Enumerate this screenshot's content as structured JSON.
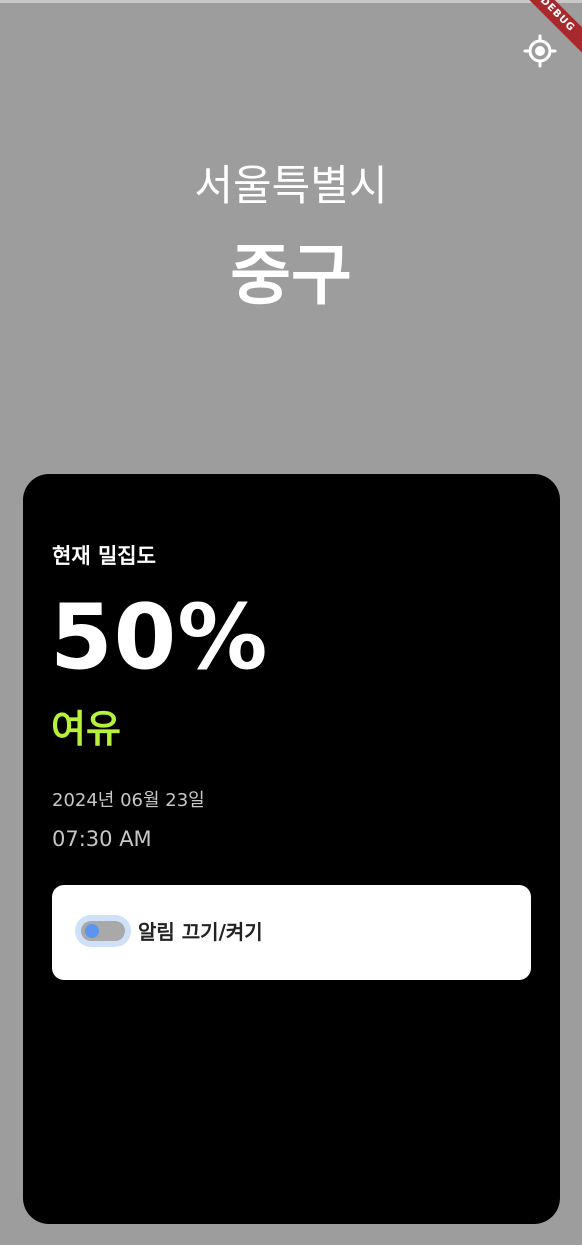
{
  "header": {
    "city": "서울특별시",
    "district": "중구",
    "locate_icon": "my-location-icon",
    "debug_banner": "DEBUG"
  },
  "card": {
    "density_label": "현재 밀집도",
    "density_value": "50%",
    "status": "여유",
    "date": "2024년 06월 23일",
    "time": "07:30 AM",
    "alarm_label": "알림 끄기/켜기",
    "alarm_enabled": false
  },
  "colors": {
    "background": "#9d9d9d",
    "card": "#000000",
    "status": "#b6f23a",
    "toggle_thumb": "#5c95ee"
  }
}
